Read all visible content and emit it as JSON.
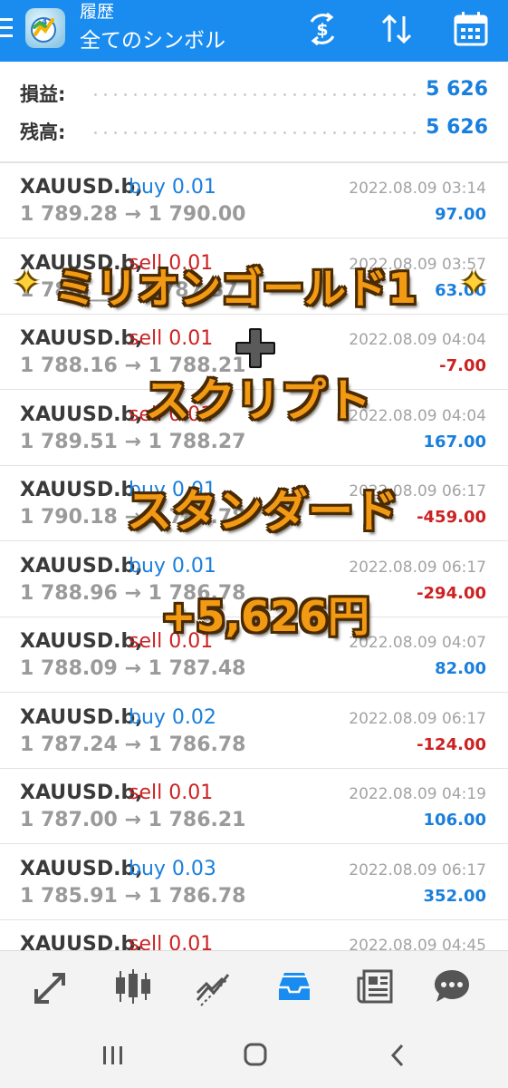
{
  "header": {
    "subtitle": "履歴",
    "title": "全てのシンボル",
    "icons": [
      "menu-icon",
      "app-logo",
      "currency-switch-icon",
      "sort-icon",
      "calendar-icon"
    ]
  },
  "summary": [
    {
      "label": "損益:",
      "value": "5 626"
    },
    {
      "label": "残高:",
      "value": "5 626"
    }
  ],
  "deals": [
    {
      "symbol": "XAUUSD.b,",
      "side": "buy",
      "side_label": "buy 0.01",
      "prices": "1 789.28 → 1 790.00",
      "time": "2022.08.09 03:14",
      "profit": "97.00",
      "profit_sign": "pos"
    },
    {
      "symbol": "XAUUSD.b,",
      "side": "sell",
      "side_label": "sell 0.01",
      "prices": "1 788.__ → 1 787.37",
      "time": "2022.08.09 03:57",
      "profit": "63.00",
      "profit_sign": "pos"
    },
    {
      "symbol": "XAUUSD.b,",
      "side": "sell",
      "side_label": "sell 0.01",
      "prices": "1 788.16 → 1 788.21",
      "time": "2022.08.09 04:04",
      "profit": "-7.00",
      "profit_sign": "neg"
    },
    {
      "symbol": "XAUUSD.b,",
      "side": "sell",
      "side_label": "sell 0.01",
      "prices": "1 789.51 → 1 788.27",
      "time": "2022.08.09 04:04",
      "profit": "167.00",
      "profit_sign": "pos"
    },
    {
      "symbol": "XAUUSD.b,",
      "side": "buy",
      "side_label": "buy 0.01",
      "prices": "1 790.18 → 1 786.78",
      "time": "2022.08.09 06:17",
      "profit": "-459.00",
      "profit_sign": "neg"
    },
    {
      "symbol": "XAUUSD.b,",
      "side": "buy",
      "side_label": "buy 0.01",
      "prices": "1 788.96 → 1 786.78",
      "time": "2022.08.09 06:17",
      "profit": "-294.00",
      "profit_sign": "neg"
    },
    {
      "symbol": "XAUUSD.b,",
      "side": "sell",
      "side_label": "sell 0.01",
      "prices": "1 788.09 → 1 787.48",
      "time": "2022.08.09 04:07",
      "profit": "82.00",
      "profit_sign": "pos"
    },
    {
      "symbol": "XAUUSD.b,",
      "side": "buy",
      "side_label": "buy 0.02",
      "prices": "1 787.24 → 1 786.78",
      "time": "2022.08.09 06:17",
      "profit": "-124.00",
      "profit_sign": "neg"
    },
    {
      "symbol": "XAUUSD.b,",
      "side": "sell",
      "side_label": "sell 0.01",
      "prices": "1 787.00 → 1 786.21",
      "time": "2022.08.09 04:19",
      "profit": "106.00",
      "profit_sign": "pos"
    },
    {
      "symbol": "XAUUSD.b,",
      "side": "buy",
      "side_label": "buy 0.03",
      "prices": "1 785.91 → 1 786.78",
      "time": "2022.08.09 06:17",
      "profit": "352.00",
      "profit_sign": "pos"
    },
    {
      "symbol": "XAUUSD.b,",
      "side": "sell",
      "side_label": "sell 0.01",
      "prices": "",
      "time": "2022.08.09 04:45",
      "profit": "",
      "profit_sign": "pos"
    }
  ],
  "overlay": {
    "line1": "ミリオンゴールド1",
    "line2": "スクリプト",
    "line3": "スタンダード",
    "line4": "+5,626円",
    "sparkle_icon": "sparkle-icon",
    "plus_icon": "plus-icon",
    "text_color": "#f39a14"
  },
  "bottom_nav": {
    "items": [
      "trade-icon",
      "chart-candles-icon",
      "line-chart-icon",
      "history-inbox-icon",
      "news-icon",
      "chat-icon"
    ],
    "active": "history-inbox-icon",
    "active_color": "#1a8cef"
  },
  "system_nav": [
    "recent-apps-icon",
    "home-icon",
    "back-icon"
  ]
}
